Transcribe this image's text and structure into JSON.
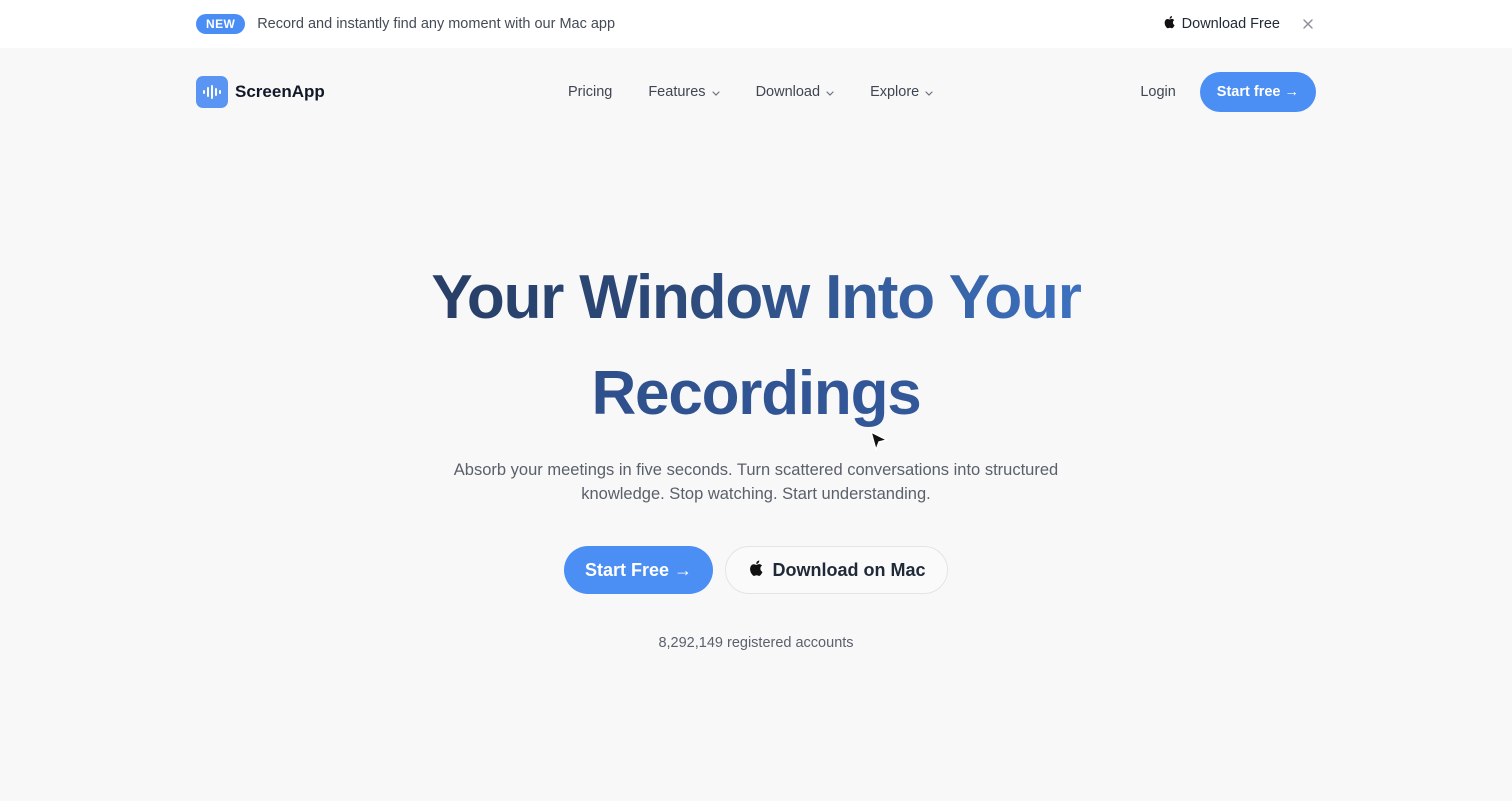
{
  "announcement": {
    "badge": "NEW",
    "text": "Record and instantly find any moment with our Mac app",
    "download_label": "Download Free",
    "icon_apple": "apple-icon",
    "icon_close": "close-icon"
  },
  "nav": {
    "brand": "ScreenApp",
    "menu": [
      {
        "label": "Pricing",
        "dropdown": false
      },
      {
        "label": "Features",
        "dropdown": true
      },
      {
        "label": "Download",
        "dropdown": true
      },
      {
        "label": "Explore",
        "dropdown": true
      }
    ],
    "login": "Login",
    "start": "Start free →"
  },
  "hero": {
    "title_line1": "Your Window Into Your",
    "title_line2": "Recordings",
    "subtitle_line1": "Absorb your meetings in five seconds. Turn scattered conversations into structured",
    "subtitle_line2": "knowledge. Stop watching. Start understanding.",
    "cta_primary": "Start Free →",
    "cta_secondary": "Download on Mac",
    "accounts": "8,292,149 registered accounts"
  },
  "colors": {
    "accent": "#4b8ef4",
    "background": "#f8f8f9",
    "title_dark": "#1e2a44",
    "title_light": "#4a86d8"
  }
}
